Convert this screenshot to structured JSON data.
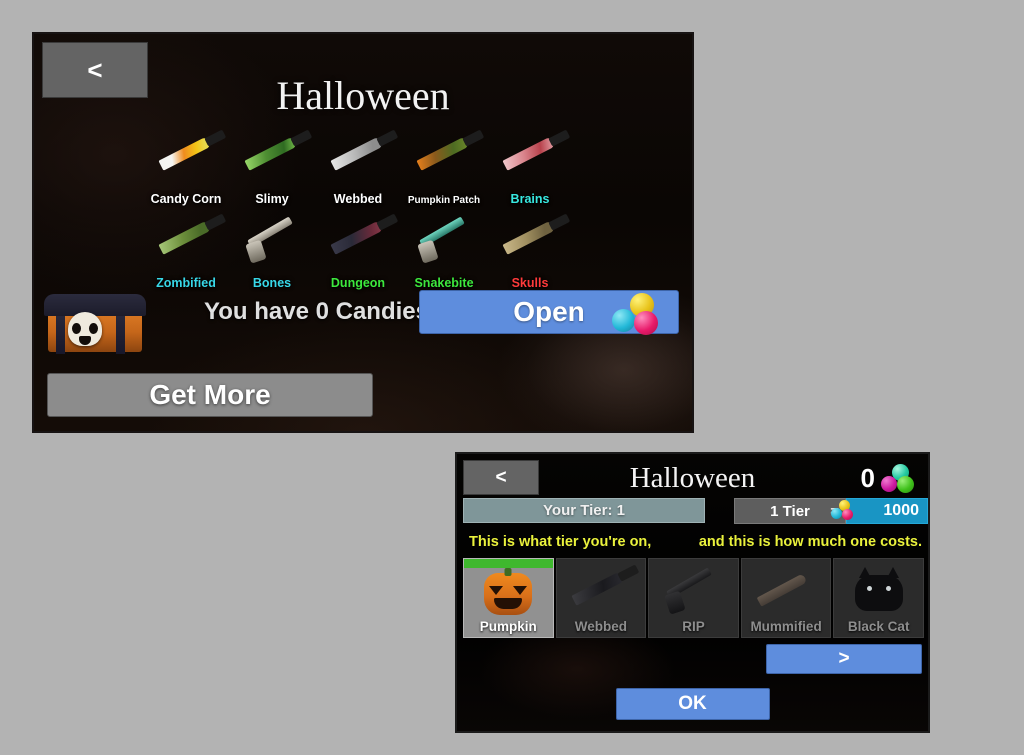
{
  "theme": {
    "page_background": "#b3b3b3",
    "panel_background": "#0a0503",
    "accent_blue": "#5e8ddd",
    "accent_cyan": "#1995c4",
    "accent_green": "#3fb82e",
    "hint_yellow": "#eaf23c",
    "tier_bar": "#7f9699"
  },
  "crate_window": {
    "back_button": "<",
    "title": "Halloween",
    "rows": [
      [
        {
          "name": "Candy Corn",
          "color": "#ffffff",
          "art": "knife",
          "blade": "linear-gradient(110deg,#f2f2ef 0%, #f5f5f2 25%, #f08c1e 48%, #f2c516 72%, #e8d84a 88%)"
        },
        {
          "name": "Slimy",
          "color": "#ffffff",
          "art": "knife",
          "blade": "linear-gradient(110deg,#9ad96a 0%, #4f8f33 40%, #2f6b22 75%, #7cc44f 100%)"
        },
        {
          "name": "Webbed",
          "color": "#ffffff",
          "art": "knife",
          "blade": "linear-gradient(110deg,#e8e8e8 0%, #b9b9b9 45%, #8d8d8d 80%)"
        },
        {
          "name": "Pumpkin Patch",
          "color": "#ffffff",
          "art": "knife",
          "blade": "linear-gradient(110deg,#e8801c 0%, #8a5a1c 35%, #4d6b22 70%, #6d8a2a 100%)"
        },
        {
          "name": "Brains",
          "color": "#38e8e0",
          "art": "knife",
          "blade": "linear-gradient(110deg,#f0c8cc 0%, #d9848c 40%, #b8424c 72%, #e8a8ae 100%)"
        }
      ],
      [
        {
          "name": "Zombified",
          "color": "#38d8e8",
          "art": "knife",
          "blade": "linear-gradient(110deg,#a8c97a 0%, #6d8f3c 45%, #4a6b28 80%)"
        },
        {
          "name": "Bones",
          "color": "#38d8e8",
          "art": "revolver",
          "blade": ""
        },
        {
          "name": "Dungeon",
          "color": "#3de83d",
          "art": "knife",
          "blade": "linear-gradient(110deg,#3a3a4a 0%, #2a2a38 40%, #6a2a3a 78%, #8a3a4a 100%)"
        },
        {
          "name": "Snakebite",
          "color": "#3de83d",
          "art": "revolver-dark",
          "blade": ""
        },
        {
          "name": "Skulls",
          "color": "#ff3b3b",
          "art": "knife",
          "blade": "linear-gradient(110deg,#cbb98a 0%, #a08f60 45%, #6f6240 80%)"
        }
      ]
    ],
    "candies_text": "You have 0 Candies",
    "open_button": "Open",
    "get_more_button": "Get More",
    "chest_icon": "halloween-chest-icon",
    "open_candy_icon": "candy-cluster-icon"
  },
  "tier_window": {
    "back_button": "<",
    "title": "Halloween",
    "balance": "0",
    "balance_icon": "candy-cluster-icon",
    "your_tier_label": "Your Tier: 1",
    "cost_label": "1 Tier",
    "cost_equals": "=",
    "cost_value": "1000",
    "cost_icon": "candy-cluster-icon",
    "hint_left": "This is what tier you're on,",
    "hint_right": "and this is how much one costs.",
    "items": [
      {
        "name": "Pumpkin",
        "selected": true,
        "art": "pumpkin"
      },
      {
        "name": "Webbed",
        "selected": false,
        "art": "knife-dark"
      },
      {
        "name": "RIP",
        "selected": false,
        "art": "revolver-dark"
      },
      {
        "name": "Mummified",
        "selected": false,
        "art": "mummy-knife"
      },
      {
        "name": "Black Cat",
        "selected": false,
        "art": "black-cat"
      }
    ],
    "next_button": ">",
    "ok_button": "OK"
  }
}
